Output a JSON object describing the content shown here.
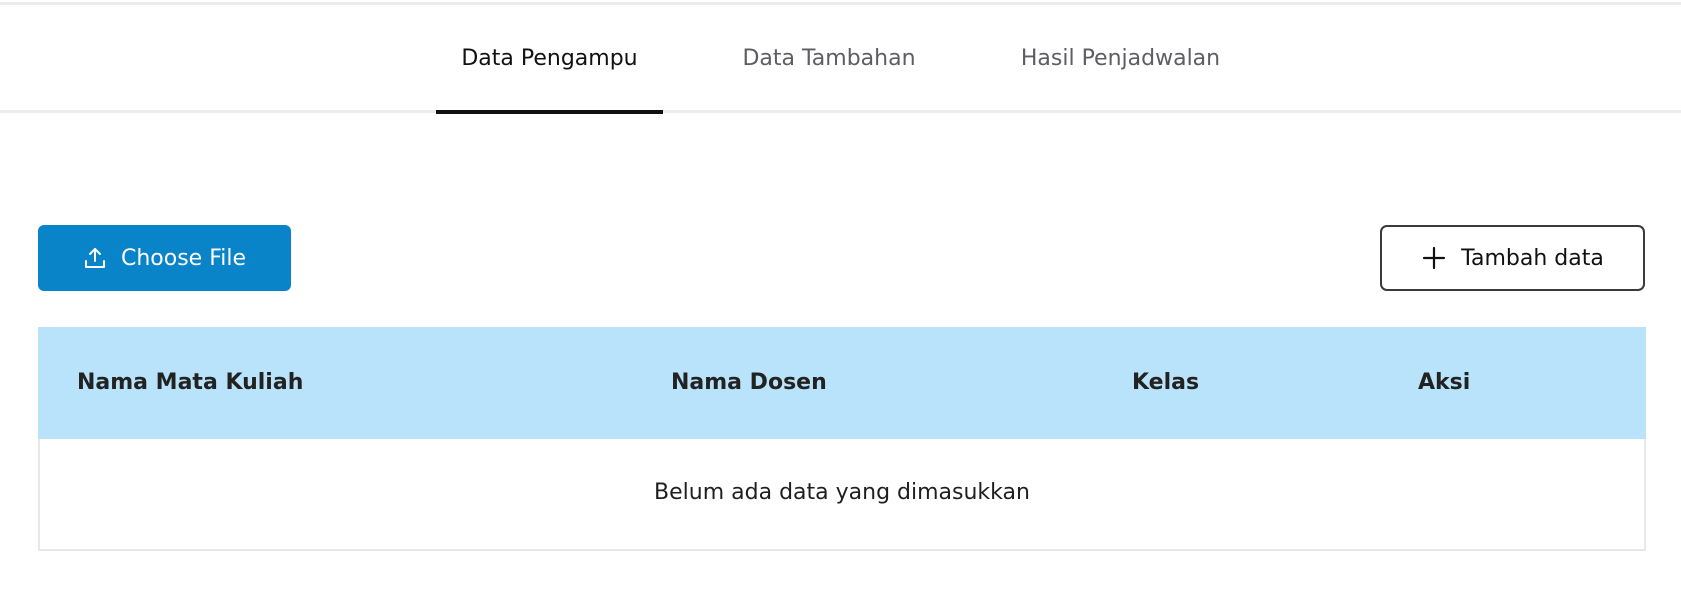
{
  "tabs": [
    {
      "label": "Data Pengampu",
      "active": true
    },
    {
      "label": "Data Tambahan",
      "active": false
    },
    {
      "label": "Hasil Penjadwalan",
      "active": false
    }
  ],
  "toolbar": {
    "choose_file_label": "Choose File",
    "choose_file_icon": "upload-icon",
    "add_data_label": "Tambah data",
    "add_data_icon": "plus-icon",
    "accent_color": "#0a84c8"
  },
  "table": {
    "header_bg": "#b9e3fa",
    "columns": [
      "Nama Mata Kuliah",
      "Nama Dosen",
      "Kelas",
      "Aksi"
    ],
    "rows": [],
    "empty_message": "Belum ada data yang dimasukkan"
  }
}
